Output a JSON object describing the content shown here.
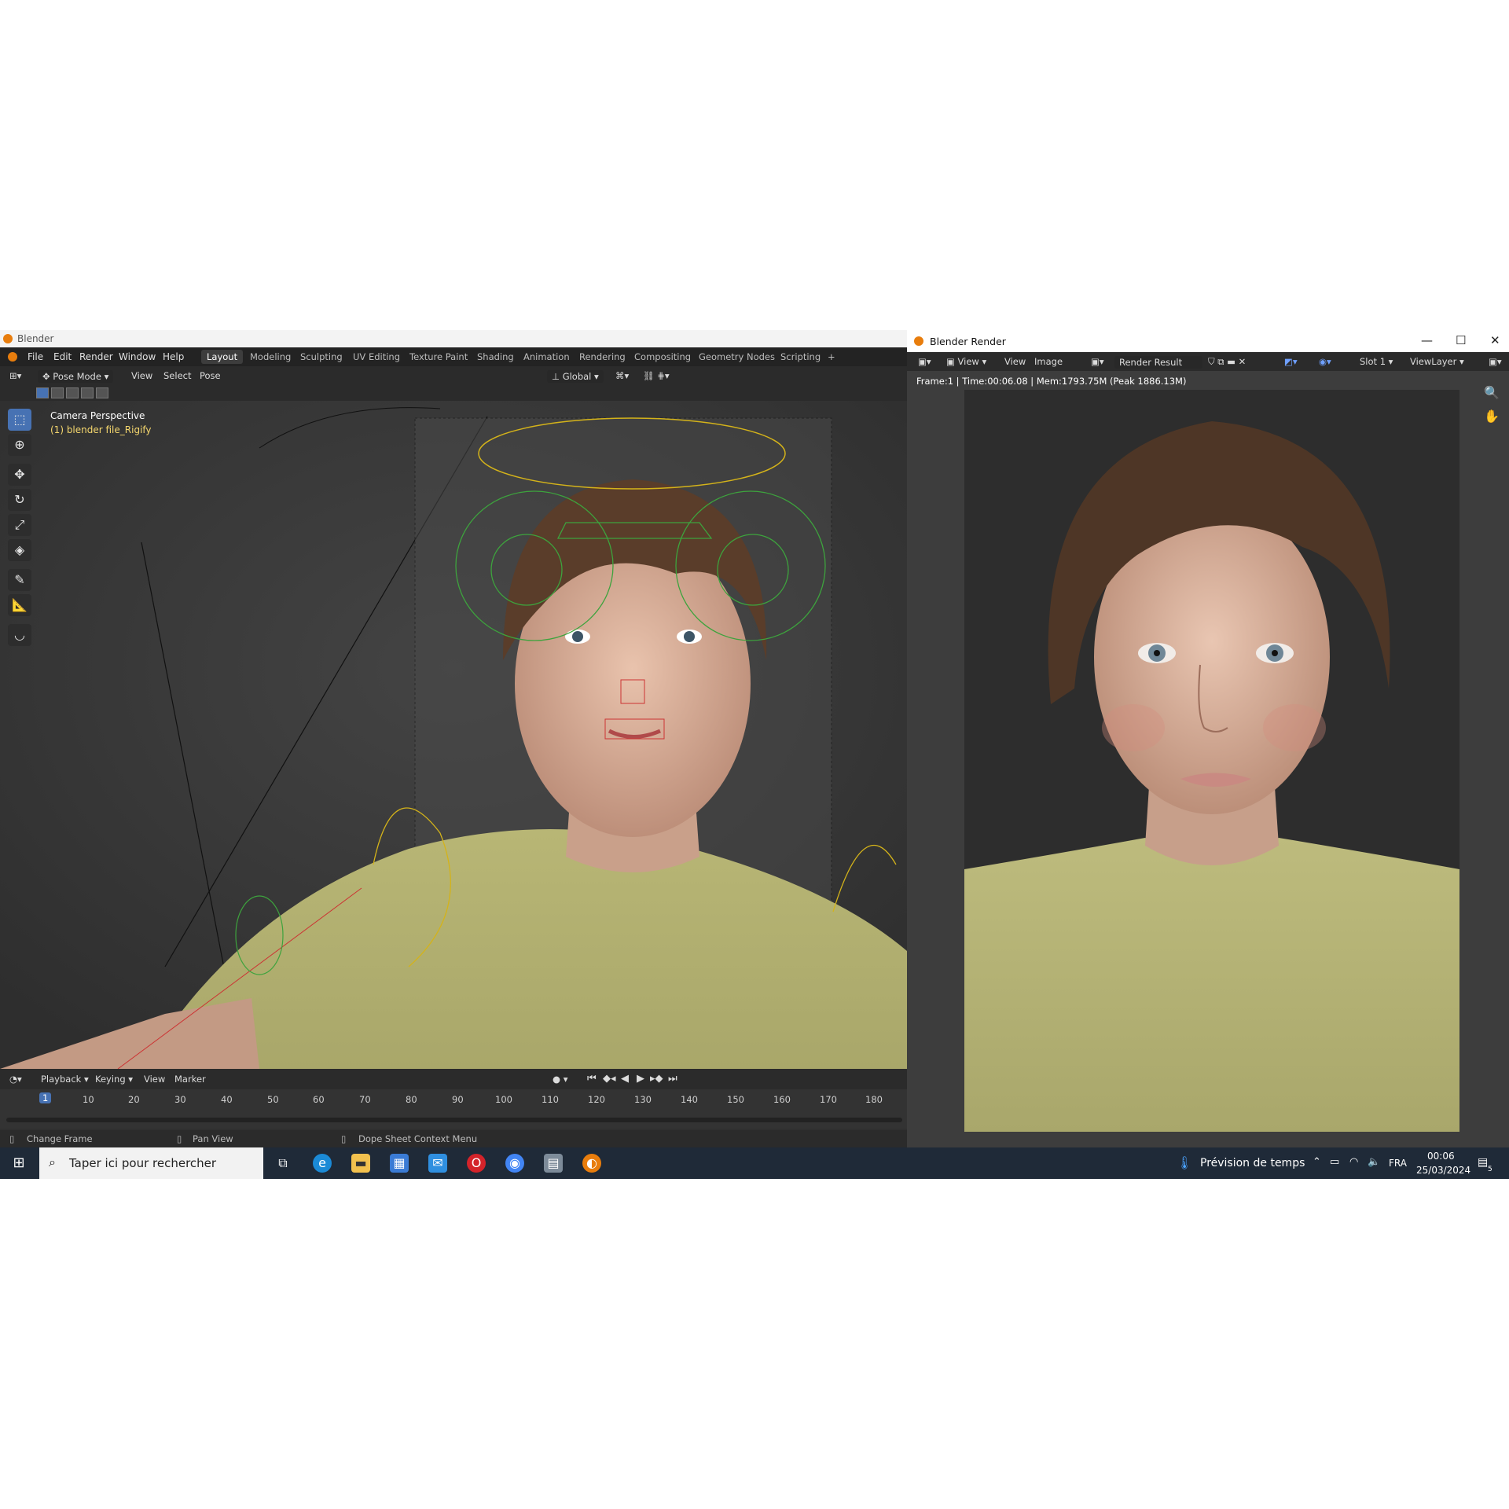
{
  "blender": {
    "title": "Blender",
    "menu": [
      "File",
      "Edit",
      "Render",
      "Window",
      "Help"
    ],
    "workspaces": [
      "Layout",
      "Modeling",
      "Sculpting",
      "UV Editing",
      "Texture Paint",
      "Shading",
      "Animation",
      "Rendering",
      "Compositing",
      "Geometry Nodes",
      "Scripting",
      "+"
    ],
    "header": {
      "mode": "Pose Mode",
      "view": "View",
      "select": "Select",
      "pose": "Pose",
      "orientation": "Global"
    },
    "viewport": {
      "camera_label": "Camera Perspective",
      "object_label": "(1) blender file_Rigify"
    },
    "timeline": {
      "menus": [
        "Playback",
        "Keying",
        "View",
        "Marker"
      ],
      "current_frame": "1",
      "ticks": [
        "10",
        "20",
        "30",
        "40",
        "50",
        "60",
        "70",
        "80",
        "90",
        "100",
        "110",
        "120",
        "130",
        "140",
        "150",
        "160",
        "170",
        "180"
      ]
    },
    "status": [
      "Change Frame",
      "Pan View",
      "Dope Sheet Context Menu"
    ]
  },
  "render_window": {
    "title": "Blender Render",
    "header": {
      "view1": "View",
      "view2": "View",
      "image": "Image",
      "result": "Render Result",
      "slot": "Slot 1",
      "layer": "ViewLayer"
    },
    "info": "Frame:1 | Time:00:06.08 | Mem:1793.75M (Peak 1886.13M)"
  },
  "taskbar": {
    "search_placeholder": "Taper ici pour rechercher",
    "weather": "Prévision de temps",
    "language": "FRA",
    "time": "00:06",
    "date": "25/03/2024",
    "notifications": "5"
  },
  "colors": {
    "blender_accent": "#e87d0d",
    "active_tool": "#4772b3",
    "shirt": "#b9b778",
    "taskbar": "#1f2a38"
  }
}
